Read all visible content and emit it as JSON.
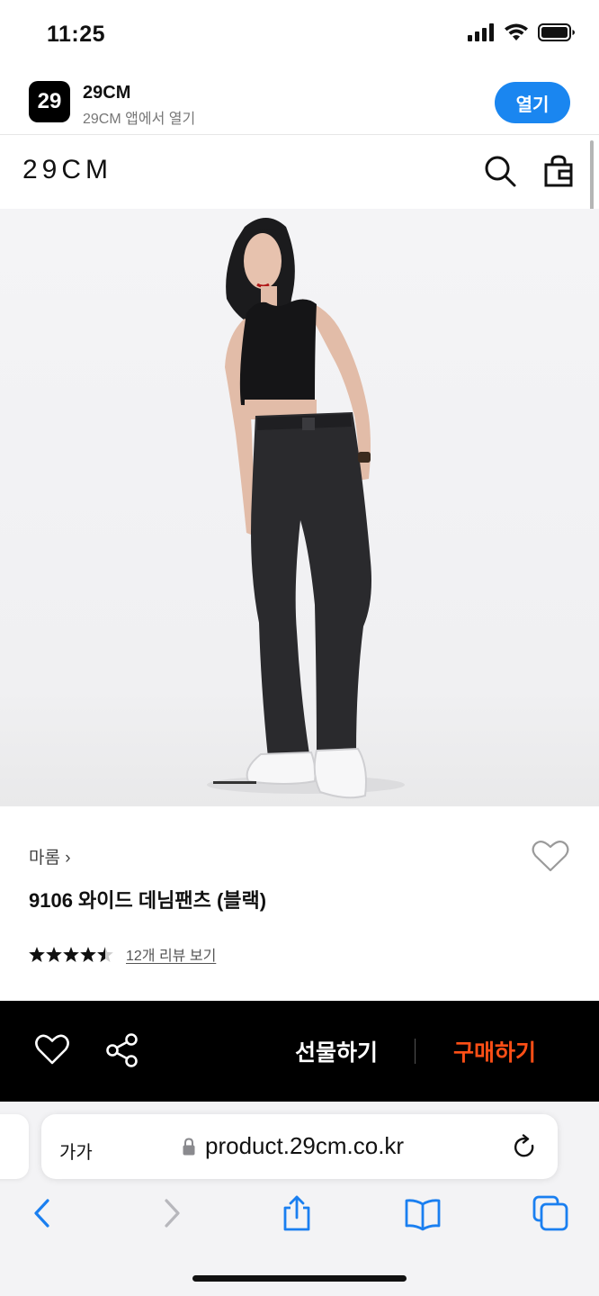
{
  "status_bar": {
    "time": "11:25",
    "icons": [
      "cellular-signal-icon",
      "wifi-icon",
      "battery-icon"
    ]
  },
  "app_banner": {
    "logo_text": "29",
    "app_name": "29CM",
    "subtitle": "29CM 앱에서 열기",
    "open_label": "열기",
    "accent_color": "#1a86f0"
  },
  "site_header": {
    "logo": "29CM",
    "icons": [
      "search-icon",
      "shopping-bag-icon"
    ]
  },
  "product": {
    "image_slide": "1",
    "brand": "마롬",
    "brand_chevron": "›",
    "title": "9106 와이드 데님팬츠 (블랙)",
    "rating": 4.5,
    "rating_max": 5,
    "review_link": "12개 리뷰 보기"
  },
  "purchase_bar": {
    "gift_label": "선물하기",
    "buy_label": "구매하기",
    "buy_color": "#ff4f16",
    "icons": [
      "heart-icon",
      "share-icon"
    ]
  },
  "browser": {
    "text_size_label": "가가",
    "url": "product.29cm.co.kr",
    "icons": [
      "lock-icon",
      "reload-icon",
      "back-icon",
      "forward-icon",
      "share-icon",
      "bookmarks-icon",
      "tabs-icon"
    ]
  }
}
